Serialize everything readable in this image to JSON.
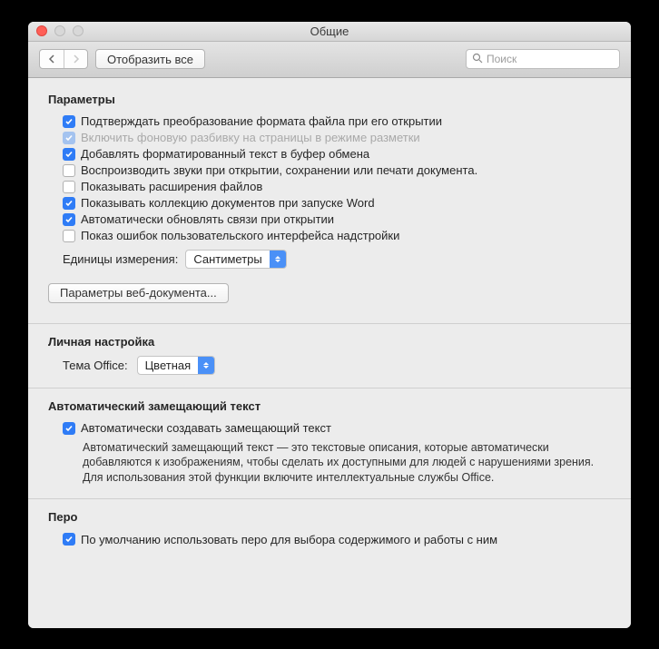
{
  "window": {
    "title": "Общие"
  },
  "toolbar": {
    "show_all": "Отобразить все",
    "search_placeholder": "Поиск"
  },
  "params": {
    "title": "Параметры",
    "items": [
      {
        "label": "Подтверждать преобразование формата файла при его открытии",
        "checked": true,
        "disabled": false
      },
      {
        "label": "Включить фоновую разбивку на страницы в режиме разметки",
        "checked": true,
        "disabled": true
      },
      {
        "label": "Добавлять форматированный текст в буфер обмена",
        "checked": true,
        "disabled": false
      },
      {
        "label": "Воспроизводить звуки при открытии, сохранении или печати документа.",
        "checked": false,
        "disabled": false
      },
      {
        "label": "Показывать расширения файлов",
        "checked": false,
        "disabled": false
      },
      {
        "label": "Показывать коллекцию документов при запуске Word",
        "checked": true,
        "disabled": false
      },
      {
        "label": "Автоматически обновлять связи при открытии",
        "checked": true,
        "disabled": false
      },
      {
        "label": "Показ ошибок пользовательского интерфейса надстройки",
        "checked": false,
        "disabled": false
      }
    ],
    "units_label": "Единицы измерения:",
    "units_value": "Сантиметры",
    "web_button": "Параметры веб-документа..."
  },
  "personal": {
    "title": "Личная настройка",
    "theme_label": "Тема Office:",
    "theme_value": "Цветная"
  },
  "alt_text": {
    "title": "Автоматический замещающий текст",
    "checkbox_label": "Автоматически создавать замещающий текст",
    "checked": true,
    "description": "Автоматический замещающий текст — это текстовые описания, которые автоматически добавляются к изображениям, чтобы сделать их доступными для людей с нарушениями зрения. Для использования этой функции включите интеллектуальные службы Office."
  },
  "pen": {
    "title": "Перо",
    "checkbox_label": "По умолчанию использовать перо для выбора содержимого и работы с ним",
    "checked": true
  }
}
